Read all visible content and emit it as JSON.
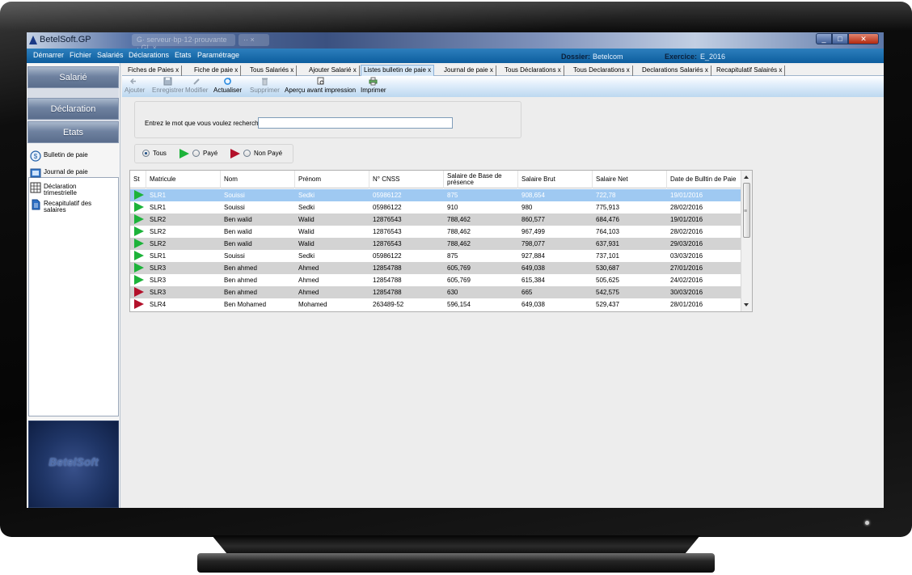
{
  "window": {
    "title": "BetelSoft.GP",
    "ghost_tabs": [
      "G· serveur·bp·12·prouvante · GL ×",
      "·· ×"
    ]
  },
  "menu": {
    "items": [
      "Démarrer",
      "Fichier",
      "Salariés",
      "Déclarations",
      "Etats",
      "Paramétrage"
    ],
    "dossier_label": "Dossier:",
    "dossier_value": "Betelcom",
    "exercice_label": "Exercice:",
    "exercice_value": "E_2016"
  },
  "sidebar": {
    "buttons": [
      "Salarié",
      "Déclaration",
      "Etats"
    ],
    "tree": [
      "Bulletin de paie",
      "Journal de paie",
      "Déclaration trimestrielle",
      "Recapitulatif des salaires"
    ],
    "brand": "BetelSoft"
  },
  "tabs": [
    "Fiches de Paies  x",
    "Fiche de paie  x",
    "Tous Salariés  x",
    "Ajouter Salarié  x",
    "Listes bulletin de paie  x",
    "Journal de paie  x",
    "Tous Déclarations  x",
    "Tous Declarations  x",
    "Declarations Salariés  x",
    "Recapitulatif Salairés  x"
  ],
  "active_tab": 4,
  "toolbar": [
    {
      "label": "Ajouter",
      "icon": "add-icon",
      "enabled": false
    },
    {
      "label": "Enregistrer",
      "icon": "save-icon",
      "enabled": false
    },
    {
      "label": "Modifier",
      "icon": "pencil-icon",
      "enabled": false
    },
    {
      "label": "Actualiser",
      "icon": "refresh-icon",
      "enabled": true
    },
    {
      "label": "Supprimer",
      "icon": "delete-icon",
      "enabled": false
    },
    {
      "label": "Aperçu avant impression",
      "icon": "print-preview-icon",
      "enabled": true
    },
    {
      "label": "Imprimer",
      "icon": "printer-icon",
      "enabled": true
    }
  ],
  "search": {
    "label": "Entrez le mot que vous voulez rechercher:",
    "value": ""
  },
  "filters": {
    "tous": "Tous",
    "paye": "Payé",
    "non_paye": "Non Payé",
    "selected": "tous"
  },
  "grid": {
    "headers": [
      "St",
      "Matricule",
      "Nom",
      "Prénom",
      "N° CNSS",
      "Salaire de Base de présence",
      "Salaire Brut",
      "Salaire Net",
      "Date de Bulltin de Paie"
    ],
    "rows": [
      {
        "status": "paye",
        "matricule": "SLR1",
        "nom": "Souissi",
        "prenom": "Sedki",
        "cnss": "05986122",
        "base": "875",
        "brut": "908,654",
        "net": "722,78",
        "date": "19/01/2016"
      },
      {
        "status": "paye",
        "matricule": "SLR1",
        "nom": "Souissi",
        "prenom": "Sedki",
        "cnss": "05986122",
        "base": "910",
        "brut": "980",
        "net": "775,913",
        "date": "28/02/2016"
      },
      {
        "status": "paye",
        "matricule": "SLR2",
        "nom": "Ben walid",
        "prenom": "Walid",
        "cnss": "12876543",
        "base": "788,462",
        "brut": "860,577",
        "net": "684,476",
        "date": "19/01/2016"
      },
      {
        "status": "paye",
        "matricule": "SLR2",
        "nom": "Ben walid",
        "prenom": "Walid",
        "cnss": "12876543",
        "base": "788,462",
        "brut": "967,499",
        "net": "764,103",
        "date": "28/02/2016"
      },
      {
        "status": "paye",
        "matricule": "SLR2",
        "nom": "Ben walid",
        "prenom": "Walid",
        "cnss": "12876543",
        "base": "788,462",
        "brut": "798,077",
        "net": "637,931",
        "date": "29/03/2016"
      },
      {
        "status": "paye",
        "matricule": "SLR1",
        "nom": "Souissi",
        "prenom": "Sedki",
        "cnss": "05986122",
        "base": "875",
        "brut": "927,884",
        "net": "737,101",
        "date": "03/03/2016"
      },
      {
        "status": "paye",
        "matricule": "SLR3",
        "nom": "Ben ahmed",
        "prenom": "Ahmed",
        "cnss": "12854788",
        "base": "605,769",
        "brut": "649,038",
        "net": "530,687",
        "date": "27/01/2016"
      },
      {
        "status": "paye",
        "matricule": "SLR3",
        "nom": "Ben ahmed",
        "prenom": "Ahmed",
        "cnss": "12854788",
        "base": "605,769",
        "brut": "615,384",
        "net": "505,625",
        "date": "24/02/2016"
      },
      {
        "status": "non_paye",
        "matricule": "SLR3",
        "nom": "Ben ahmed",
        "prenom": "Ahmed",
        "cnss": "12854788",
        "base": "630",
        "brut": "665",
        "net": "542,575",
        "date": "30/03/2016"
      },
      {
        "status": "non_paye",
        "matricule": "SLR4",
        "nom": "Ben Mohamed",
        "prenom": "Mohamed",
        "cnss": "263489-52",
        "base": "596,154",
        "brut": "649,038",
        "net": "529,437",
        "date": "28/01/2016"
      }
    ],
    "selected_row": 0
  },
  "colors": {
    "paye": "#1db33a",
    "non_paye": "#b3112b",
    "selection": "#9fc9f2",
    "menubar": "#0d5e9e"
  }
}
